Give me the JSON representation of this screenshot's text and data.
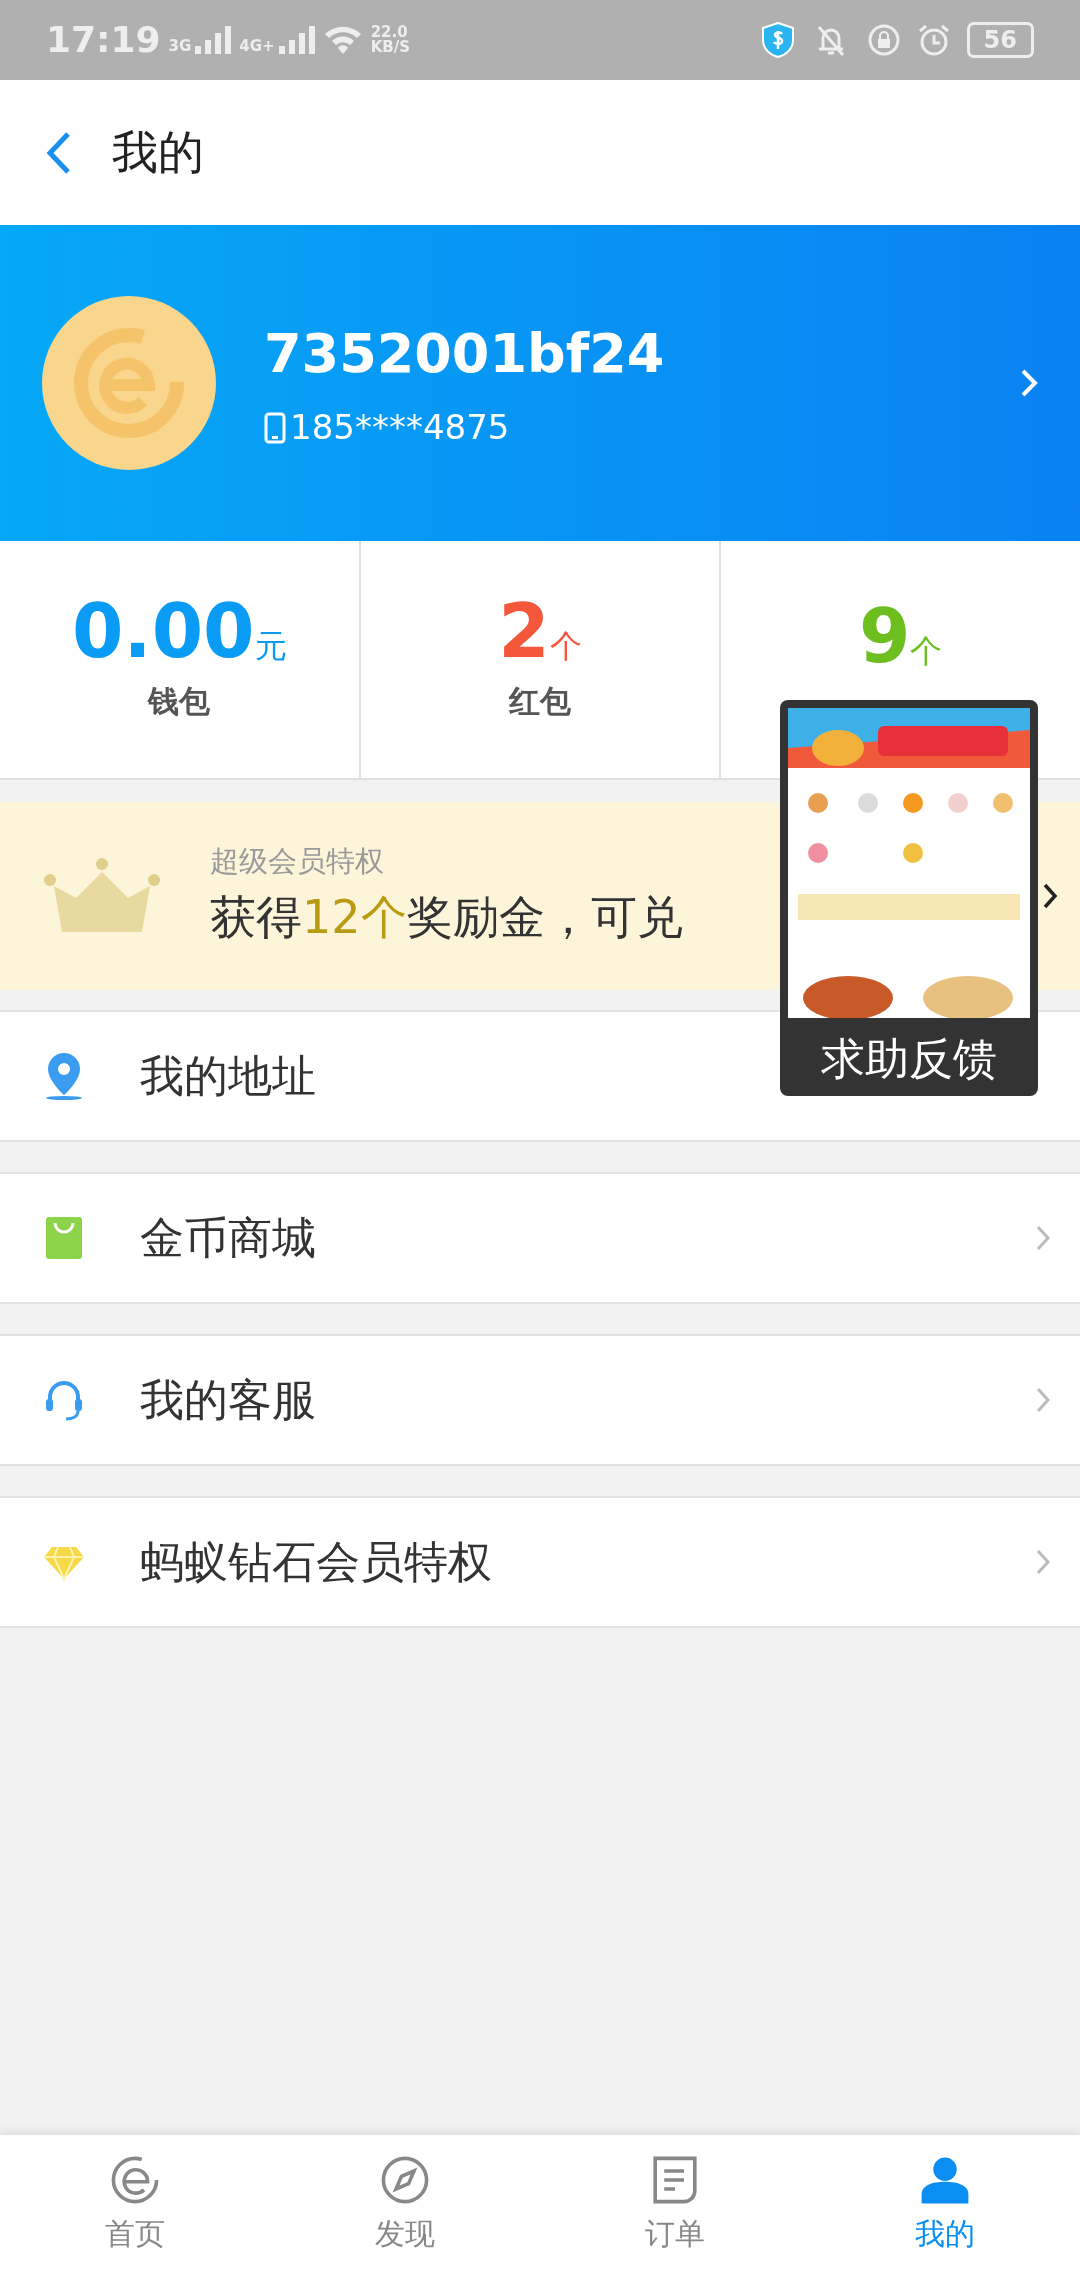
{
  "status_bar": {
    "time": "17:19",
    "network_1": "3G",
    "network_2": "4G+",
    "speed_value": "22.0",
    "speed_unit": "KB/S",
    "battery": "56"
  },
  "header": {
    "title": "我的"
  },
  "profile": {
    "name": "7352001bf24",
    "phone": "185****4875"
  },
  "stats": [
    {
      "value": "0.00",
      "unit": "元",
      "label": "钱包",
      "color": "#0a9cf5"
    },
    {
      "value": "2",
      "unit": "个",
      "label": "红包",
      "color": "#f5573b"
    },
    {
      "value": "9",
      "unit": "个",
      "color": "#6cbf1e"
    }
  ],
  "banner": {
    "caption": "超级会员特权",
    "text_parts": [
      {
        "text": "获得",
        "highlight": false
      },
      {
        "text": "12个",
        "highlight": true
      },
      {
        "text": "奖励金，可兑",
        "highlight": false
      }
    ]
  },
  "menu": [
    {
      "label": "我的地址",
      "kind": "location",
      "chevron": false
    },
    {
      "label": "金币商城",
      "kind": "shop",
      "chevron": true
    },
    {
      "label": "我的客服",
      "kind": "service",
      "chevron": true
    },
    {
      "label": "蚂蚁钻石会员特权",
      "kind": "diamond",
      "chevron": true
    }
  ],
  "floating_help": {
    "label": "求助反馈"
  },
  "tabs": [
    {
      "label": "首页",
      "kind": "home",
      "selected": false
    },
    {
      "label": "发现",
      "kind": "discover",
      "selected": false
    },
    {
      "label": "订单",
      "kind": "orders",
      "selected": false
    },
    {
      "label": "我的",
      "kind": "profile",
      "selected": true
    }
  ]
}
